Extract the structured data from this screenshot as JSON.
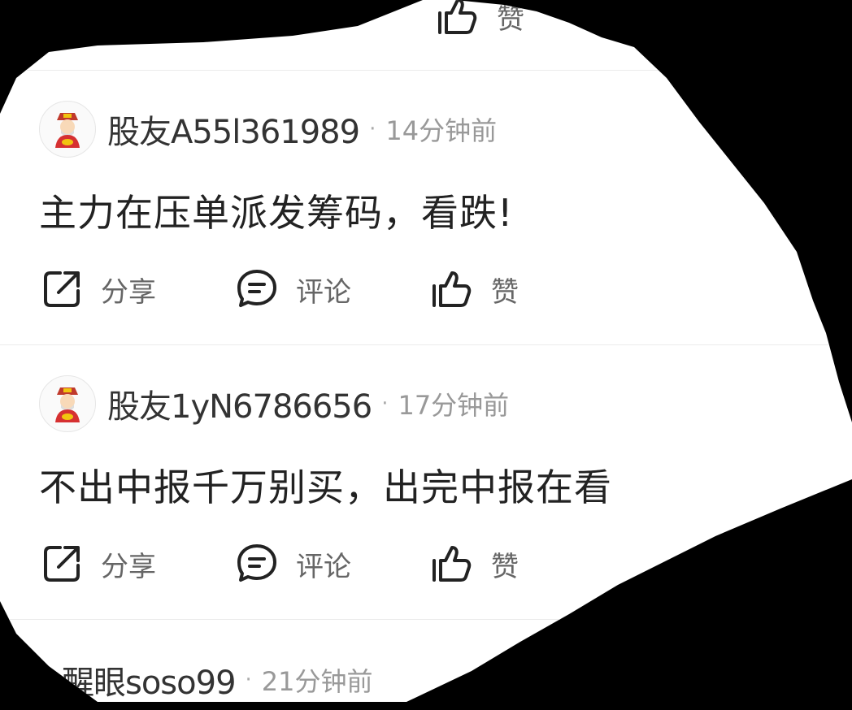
{
  "icons": {
    "share": "share-icon",
    "comment": "comment-icon",
    "like": "thumbs-up-icon",
    "avatar": "fortune-god-avatar-icon"
  },
  "top_partial": {
    "like_label": "赞"
  },
  "comments": [
    {
      "username": "股友A55l361989",
      "separator": "·",
      "time": "14分钟前",
      "text": "主力在压单派发筹码，看跌!",
      "actions": {
        "share": "分享",
        "comment": "评论",
        "like": "赞"
      }
    },
    {
      "username": "股友1yN6786656",
      "separator": "·",
      "time": "17分钟前",
      "text": "不出中报千万别买，出完中报在看",
      "actions": {
        "share": "分享",
        "comment": "评论",
        "like": "赞"
      }
    },
    {
      "username": "醒眼soso99",
      "separator": "·",
      "time": "21分钟前"
    }
  ]
}
